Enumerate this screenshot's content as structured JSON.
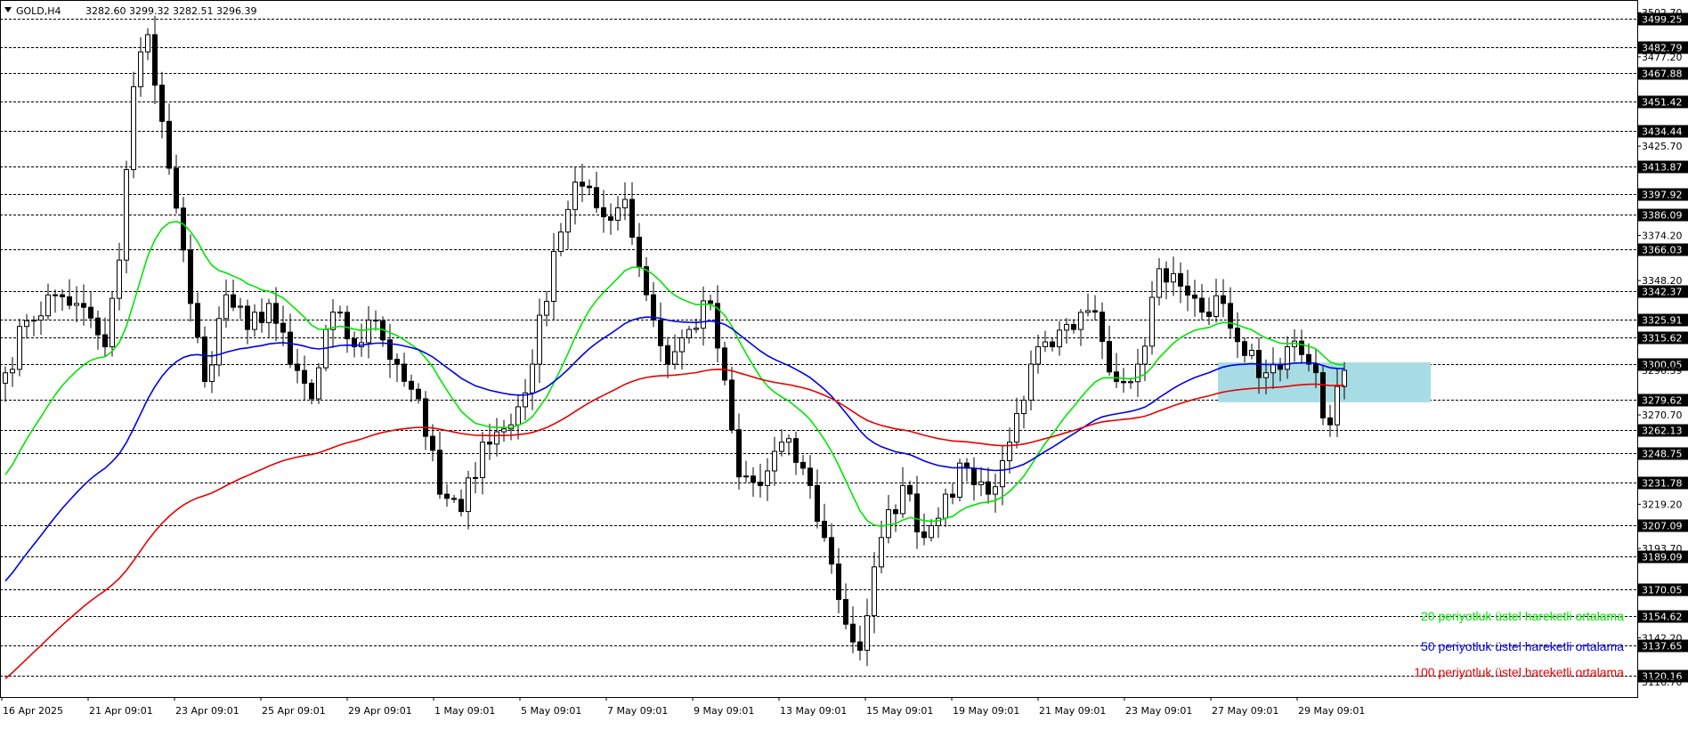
{
  "header": {
    "symbol": "GOLD,H4",
    "ohlc": "3282.60 3299.32 3282.51 3296.39"
  },
  "chart_data": {
    "type": "candlestick",
    "ylim": [
      3108,
      3510
    ],
    "axis_prices": [
      "3502.70",
      "3477.20",
      "3425.70",
      "3374.20",
      "3348.20",
      "3296.39",
      "3270.70",
      "3219.20",
      "3193.70",
      "3142.20",
      "3116.70"
    ],
    "levels": [
      "3499.25",
      "3482.79",
      "3467.88",
      "3451.42",
      "3434.44",
      "3413.87",
      "3397.92",
      "3386.09",
      "3366.03",
      "3342.37",
      "3325.91",
      "3315.62",
      "3300.05",
      "3279.62",
      "3262.13",
      "3248.75",
      "3231.78",
      "3207.09",
      "3189.09",
      "3170.05",
      "3154.62",
      "3137.65",
      "3120.16"
    ],
    "x_labels": [
      "16 Apr 2025",
      "21 Apr 09:01",
      "23 Apr 09:01",
      "25 Apr 09:01",
      "29 Apr 09:01",
      "1 May 09:01",
      "5 May 09:01",
      "7 May 09:01",
      "9 May 09:01",
      "13 May 09:01",
      "15 May 09:01",
      "19 May 09:01",
      "21 May 09:01",
      "23 May 09:01",
      "27 May 09:01",
      "29 May 09:01"
    ],
    "close_anchors": [
      [
        0,
        3295
      ],
      [
        3,
        3325
      ],
      [
        7,
        3340
      ],
      [
        10,
        3335
      ],
      [
        14,
        3310
      ],
      [
        16,
        3360
      ],
      [
        18,
        3460
      ],
      [
        20,
        3490
      ],
      [
        22,
        3440
      ],
      [
        24,
        3390
      ],
      [
        26,
        3335
      ],
      [
        28,
        3290
      ],
      [
        31,
        3340
      ],
      [
        34,
        3320
      ],
      [
        37,
        3335
      ],
      [
        40,
        3300
      ],
      [
        43,
        3280
      ],
      [
        46,
        3330
      ],
      [
        49,
        3310
      ],
      [
        52,
        3325
      ],
      [
        55,
        3300
      ],
      [
        58,
        3280
      ],
      [
        61,
        3225
      ],
      [
        64,
        3215
      ],
      [
        67,
        3255
      ],
      [
        71,
        3265
      ],
      [
        74,
        3300
      ],
      [
        77,
        3365
      ],
      [
        80,
        3405
      ],
      [
        84,
        3385
      ],
      [
        87,
        3395
      ],
      [
        90,
        3340
      ],
      [
        93,
        3300
      ],
      [
        96,
        3320
      ],
      [
        99,
        3335
      ],
      [
        103,
        3235
      ],
      [
        106,
        3230
      ],
      [
        109,
        3255
      ],
      [
        112,
        3240
      ],
      [
        115,
        3200
      ],
      [
        118,
        3150
      ],
      [
        120,
        3135
      ],
      [
        123,
        3200
      ],
      [
        126,
        3230
      ],
      [
        129,
        3200
      ],
      [
        132,
        3225
      ],
      [
        135,
        3240
      ],
      [
        138,
        3225
      ],
      [
        141,
        3255
      ],
      [
        144,
        3300
      ],
      [
        147,
        3310
      ],
      [
        150,
        3320
      ],
      [
        153,
        3330
      ],
      [
        156,
        3290
      ],
      [
        159,
        3300
      ],
      [
        162,
        3355
      ],
      [
        165,
        3345
      ],
      [
        168,
        3330
      ],
      [
        171,
        3335
      ],
      [
        174,
        3305
      ],
      [
        177,
        3295
      ],
      [
        180,
        3310
      ],
      [
        183,
        3300
      ],
      [
        186,
        3265
      ],
      [
        188,
        3296.39
      ]
    ],
    "candle_count": 189,
    "seed": 7,
    "series": [
      {
        "name": "20 periyotluk üstel hareketli ortalama",
        "period": 20,
        "start": 3230,
        "color": "#00e600"
      },
      {
        "name": "50 periyotluk üstel hareketli ortalama",
        "period": 50,
        "start": 3170,
        "color": "#0000e6"
      },
      {
        "name": "100 periyotluk üstel hareketli ortalama",
        "period": 100,
        "start": 3115,
        "color": "#e60000"
      }
    ],
    "zone": {
      "from_candle": 171,
      "price_high": 3301,
      "price_low": 3278,
      "color": "#a8dce4"
    },
    "colors": {
      "bull_body": "#ffffff",
      "bear_body": "#000000",
      "grid": "#000000",
      "bg": "#ffffff"
    }
  }
}
